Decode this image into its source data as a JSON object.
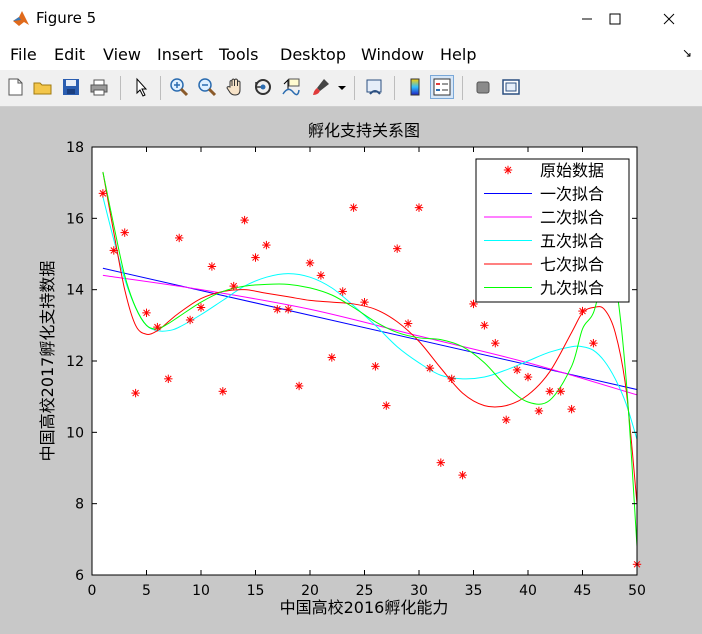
{
  "window": {
    "title": "Figure 5",
    "minimize": "—",
    "maximize": "☐",
    "close": "✕"
  },
  "menu": [
    "File",
    "Edit",
    "View",
    "Insert",
    "Tools",
    "Desktop",
    "Window",
    "Help"
  ],
  "toolbar_icons": [
    "new-figure-icon",
    "open-icon",
    "save-icon",
    "print-icon",
    "pointer-icon",
    "zoom-in-icon",
    "zoom-out-icon",
    "pan-icon",
    "rotate-icon",
    "data-cursor-icon",
    "brush-icon",
    "brush-dropdown-icon",
    "link-plot-icon",
    "colorbar-icon",
    "legend-icon",
    "hide-plot-tools-icon",
    "show-plot-tools-icon"
  ],
  "chart_data": {
    "type": "scatter",
    "title": "孵化支持关系图",
    "xlabel": "中国高校2016孵化能力",
    "ylabel": "中国高校2017孵化支持数据",
    "xlim": [
      0,
      50
    ],
    "ylim": [
      6,
      18
    ],
    "xticks": [
      0,
      5,
      10,
      15,
      20,
      25,
      30,
      35,
      40,
      45,
      50
    ],
    "yticks": [
      6,
      8,
      10,
      12,
      14,
      16,
      18
    ],
    "legend_position": "top-right",
    "scatter": {
      "name": "原始数据",
      "color": "#ff0000",
      "x": [
        1,
        2,
        3,
        4,
        5,
        6,
        7,
        8,
        9,
        10,
        11,
        12,
        13,
        14,
        15,
        16,
        17,
        18,
        19,
        20,
        21,
        22,
        23,
        24,
        25,
        26,
        27,
        28,
        29,
        30,
        31,
        32,
        33,
        34,
        35,
        36,
        37,
        38,
        39,
        40,
        41,
        42,
        43,
        44,
        45,
        46,
        47,
        48,
        49,
        50
      ],
      "y": [
        16.7,
        15.1,
        15.6,
        11.1,
        13.35,
        12.95,
        11.5,
        15.45,
        13.15,
        13.5,
        14.65,
        11.15,
        14.1,
        15.95,
        14.9,
        15.25,
        13.45,
        13.45,
        11.3,
        14.75,
        14.4,
        12.1,
        13.95,
        16.3,
        13.65,
        11.85,
        10.75,
        15.15,
        13.05,
        16.3,
        11.8,
        9.15,
        11.5,
        8.8,
        13.6,
        13.0,
        12.5,
        10.35,
        11.75,
        11.55,
        10.6,
        11.15,
        11.15,
        10.65,
        13.4,
        12.5,
        null,
        null,
        null,
        6.3
      ]
    },
    "series": [
      {
        "name": "一次拟合",
        "color": "#0000ff",
        "x": [
          1,
          50
        ],
        "y": [
          14.6,
          11.2
        ]
      },
      {
        "name": "二次拟合",
        "color": "#ff00ff",
        "x": [
          1,
          10,
          20,
          30,
          40,
          50
        ],
        "y": [
          14.4,
          14.0,
          13.45,
          12.7,
          11.95,
          11.05
        ]
      },
      {
        "name": "五次拟合",
        "color": "#00ffff",
        "x": [
          1,
          2,
          3,
          4,
          5,
          6,
          7,
          8,
          10,
          12,
          14,
          16,
          18,
          20,
          22,
          24,
          26,
          28,
          30,
          32,
          34,
          36,
          38,
          40,
          42,
          44,
          45,
          46,
          47,
          48,
          49,
          50
        ],
        "y": [
          16.6,
          15.4,
          14.3,
          13.5,
          13.0,
          12.85,
          12.85,
          12.95,
          13.3,
          13.7,
          14.1,
          14.35,
          14.45,
          14.35,
          14.05,
          13.55,
          13.0,
          12.4,
          11.95,
          11.6,
          11.5,
          11.55,
          11.75,
          12.0,
          12.25,
          12.4,
          12.4,
          12.3,
          12.0,
          11.5,
          10.8,
          9.8
        ]
      },
      {
        "name": "七次拟合",
        "color": "#ff0000",
        "x": [
          1,
          2,
          3,
          4,
          5,
          6,
          7,
          8,
          10,
          12,
          14,
          16,
          18,
          20,
          22,
          24,
          26,
          28,
          30,
          32,
          34,
          36,
          38,
          40,
          42,
          44,
          45,
          46,
          47,
          48,
          49,
          50
        ],
        "y": [
          17.3,
          15.6,
          14.0,
          13.0,
          12.75,
          12.85,
          13.1,
          13.35,
          13.75,
          13.95,
          14.0,
          13.9,
          13.8,
          13.7,
          13.65,
          13.6,
          13.45,
          13.1,
          12.55,
          11.8,
          11.1,
          10.75,
          10.75,
          11.05,
          11.7,
          12.8,
          13.35,
          13.5,
          13.45,
          12.8,
          11.2,
          8.0
        ]
      },
      {
        "name": "九次拟合",
        "color": "#00ff00",
        "x": [
          1,
          2,
          3,
          4,
          5,
          6,
          7,
          8,
          10,
          12,
          14,
          16,
          18,
          20,
          22,
          24,
          26,
          28,
          30,
          32,
          34,
          36,
          38,
          40,
          42,
          44,
          45,
          46,
          47,
          48,
          49,
          50
        ],
        "y": [
          17.3,
          15.8,
          14.4,
          13.5,
          13.0,
          12.9,
          13.05,
          13.25,
          13.65,
          13.95,
          14.1,
          14.15,
          14.15,
          14.05,
          13.85,
          13.5,
          13.1,
          12.8,
          12.65,
          12.6,
          12.4,
          11.95,
          11.3,
          10.85,
          10.9,
          11.85,
          12.9,
          13.35,
          14.4,
          14.2,
          11.5,
          6.8
        ]
      }
    ]
  }
}
